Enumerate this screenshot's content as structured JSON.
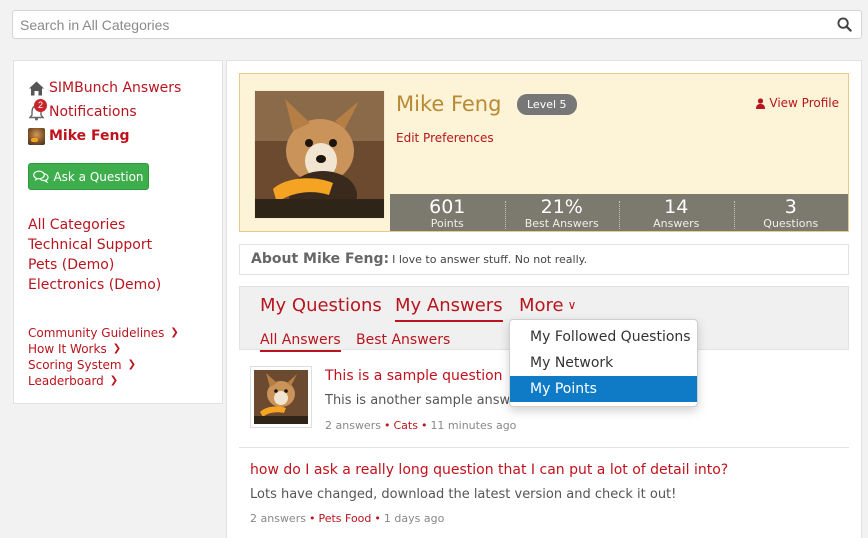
{
  "search": {
    "placeholder": "Search in All Categories"
  },
  "sidebar": {
    "site_name": "SIMBunch Answers",
    "notifications_label": "Notifications",
    "notifications_count": "2",
    "user_name": "Mike Feng",
    "ask_button": "Ask a Question",
    "categories": [
      "All Categories",
      "Technical Support",
      "Pets (Demo)",
      "Electronics (Demo)"
    ],
    "footer_links": [
      "Community Guidelines",
      "How It Works",
      "Scoring System",
      "Leaderboard"
    ]
  },
  "profile": {
    "name": "Mike Feng",
    "level": "Level 5",
    "view_profile": "View Profile",
    "edit_preferences": "Edit Preferences",
    "stats": [
      {
        "value": "601",
        "label": "Points"
      },
      {
        "value": "21%",
        "label": "Best Answers"
      },
      {
        "value": "14",
        "label": "Answers"
      },
      {
        "value": "3",
        "label": "Questions"
      }
    ]
  },
  "about": {
    "label": "About Mike Feng:",
    "text": "I love to answer stuff. No not really."
  },
  "tabs": {
    "items": [
      "My Questions",
      "My Answers",
      "More"
    ],
    "active": "My Answers",
    "subtabs": [
      "All Answers",
      "Best Answers"
    ],
    "active_subtab": "All Answers"
  },
  "dropdown": {
    "items": [
      "My Followed Questions",
      "My Network",
      "My Points"
    ],
    "active": "My Points"
  },
  "questions": [
    {
      "title": "This is a sample question",
      "desc": "This is another sample answer",
      "answers": "2 answers",
      "category": "Cats",
      "time": "11 minutes ago"
    },
    {
      "title": "how do I ask a really long question that I can put a lot of detail into?",
      "desc": "Lots have changed, download the latest version and check it out!",
      "answers": "2 answers",
      "category": "Pets Food",
      "time": "1 days ago"
    }
  ],
  "colors": {
    "accent": "#b8151e",
    "button_green": "#3eae4d",
    "stats_bg": "#7c796f",
    "profile_bg": "#fdf3d6",
    "dropdown_active": "#0f7bc7"
  }
}
